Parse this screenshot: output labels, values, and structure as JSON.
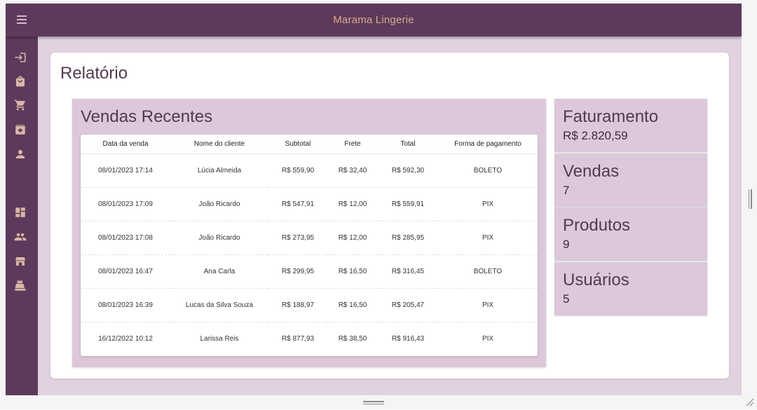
{
  "app": {
    "title": "Marama Lingerie"
  },
  "page": {
    "title": "Relatório"
  },
  "recent_sales": {
    "title": "Vendas Recentes",
    "columns": [
      "Data da venda",
      "Nome do cliente",
      "Subtotal",
      "Frete",
      "Total",
      "Forma de pagamento"
    ],
    "rows": [
      [
        "08/01/2023 17:14",
        "Lúcia Almeida",
        "R$ 559,90",
        "R$ 32,40",
        "R$ 592,30",
        "BOLETO"
      ],
      [
        "08/01/2023 17:09",
        "João Ricardo",
        "R$ 547,91",
        "R$ 12,00",
        "R$ 559,91",
        "PIX"
      ],
      [
        "08/01/2023 17:08",
        "João Ricardo",
        "R$ 273,95",
        "R$ 12,00",
        "R$ 285,95",
        "PIX"
      ],
      [
        "08/01/2023 16:47",
        "Ana Carla",
        "R$ 299,95",
        "R$ 16,50",
        "R$ 316,45",
        "BOLETO"
      ],
      [
        "08/01/2023 16:39",
        "Lucas da Silva Souza",
        "R$ 188,97",
        "R$ 16,50",
        "R$ 205,47",
        "PIX"
      ],
      [
        "16/12/2022 10:12",
        "Larissa Reis",
        "R$ 877,93",
        "R$ 38,50",
        "R$ 916,43",
        "PIX"
      ]
    ]
  },
  "stats": [
    {
      "label": "Faturamento",
      "value": "R$ 2.820,59"
    },
    {
      "label": "Vendas",
      "value": "7"
    },
    {
      "label": "Produtos",
      "value": "9"
    },
    {
      "label": "Usuários",
      "value": "5"
    }
  ],
  "sidebar": {
    "icons": [
      "login-icon",
      "shopping-bag-icon",
      "cart-icon",
      "archive-icon",
      "person-icon",
      "dashboard-icon",
      "people-icon",
      "store-icon",
      "cash-register-icon"
    ]
  },
  "colors": {
    "topbar": "#5d3a5b",
    "title_accent": "#d8a98c",
    "icon": "#d8b7a8",
    "background": "#e2d2e0",
    "panel": "#dcc8da",
    "heading": "#523a4e"
  }
}
